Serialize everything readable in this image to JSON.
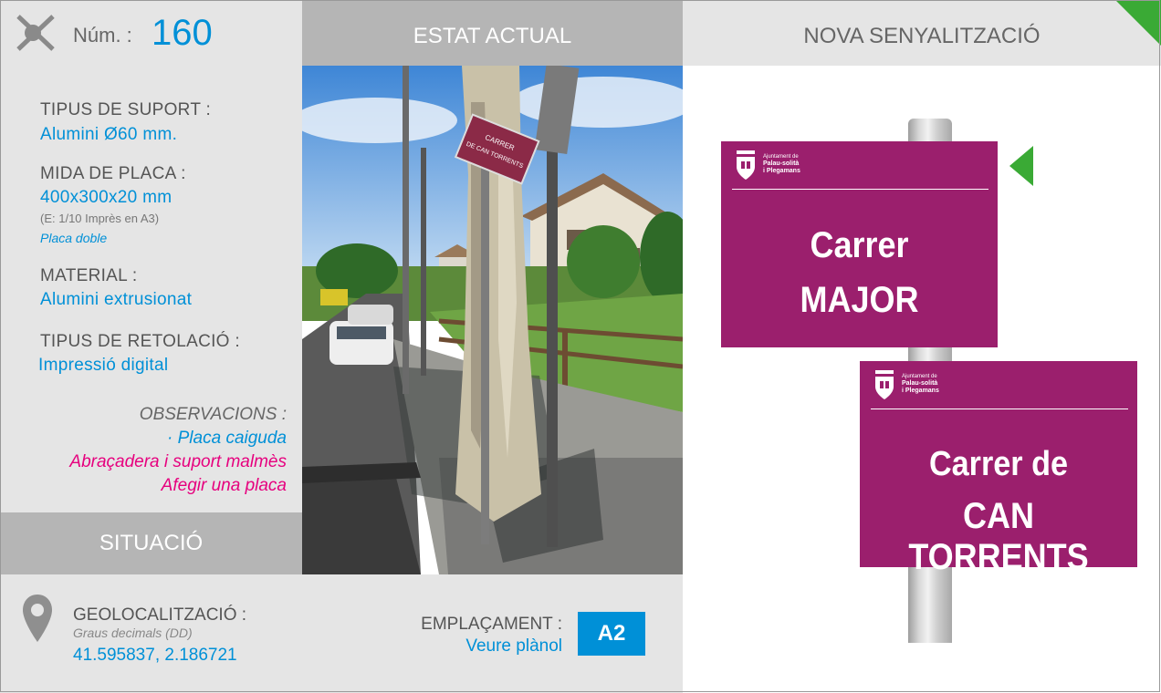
{
  "header": {
    "num_label": "Núm. :",
    "num_value": "160",
    "estat_label": "ESTAT ACTUAL",
    "nova_label": "NOVA SENYALITZACIÓ"
  },
  "specs": {
    "suport_label": "TIPUS DE SUPORT :",
    "suport_value": "Alumini Ø60 mm.",
    "mida_label": "MIDA DE PLACA :",
    "mida_value": "400x300x20 mm",
    "mida_note": "(E: 1/10 Imprès en A3)",
    "mida_extra": "Placa doble",
    "material_label": "MATERIAL :",
    "material_value": "Alumini extrusionat",
    "retolacio_label": "TIPUS DE RETOLACIÓ :",
    "retolacio_value": "Impressió digital"
  },
  "observacions": {
    "label": "OBSERVACIONS :",
    "line1": "· Placa caiguda",
    "line2": "Abraçadera i suport malmès",
    "line3": "Afegir una placa"
  },
  "situacio_label": "SITUACIÓ",
  "geo": {
    "label": "GEOLOCALITZACIÓ :",
    "sub": "Graus decimals (DD)",
    "value": "41.595837, 2.186721"
  },
  "emplacament": {
    "label": "EMPLAÇAMENT :",
    "value": "Veure plànol",
    "badge": "A2"
  },
  "photo_sign": {
    "line1": "CARRER",
    "line2": "DE CAN TORRENTS"
  },
  "plates": [
    {
      "org_line1": "Ajuntament de",
      "org_line2": "Palau-solità",
      "org_line3": "i Plegamans",
      "name_line1": "Carrer",
      "name_line2": "MAJOR"
    },
    {
      "org_line1": "Ajuntament de",
      "org_line2": "Palau-solità",
      "org_line3": "i Plegamans",
      "name_line1": "Carrer de",
      "name_line2": "CAN TORRENTS"
    }
  ],
  "colors": {
    "accent_blue": "#0090d7",
    "accent_magenta": "#e6007e",
    "plate_purple": "#9b1f6d",
    "arrow_green": "#3aaa35",
    "header_gray": "#b5b5b5",
    "panel_gray": "#e5e5e5"
  },
  "icons": {
    "header_icon": "crossed-arrow-icon",
    "geo_icon": "map-pin-icon",
    "plate_logo": "municipal-shield-icon",
    "direction_icon": "green-arrow-left-icon"
  }
}
